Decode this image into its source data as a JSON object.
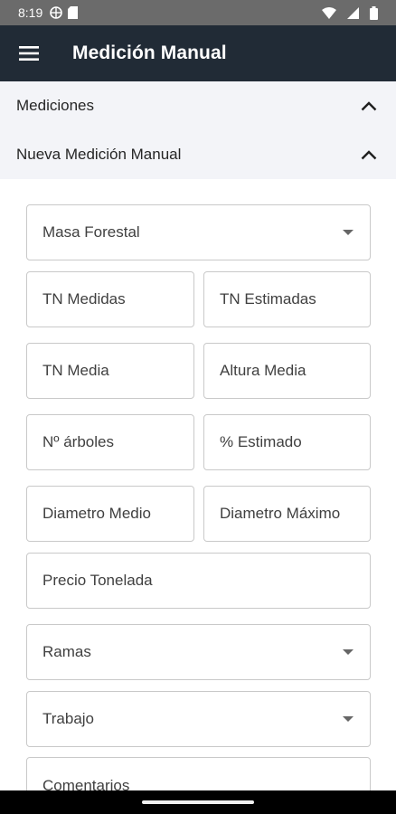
{
  "status_bar": {
    "time": "8:19",
    "icons_left": [
      "globe-icon",
      "sim-card-icon"
    ],
    "icons_right": [
      "wifi-icon",
      "signal-icon",
      "battery-icon"
    ]
  },
  "app_bar": {
    "title": "Medición Manual",
    "menu_icon": "hamburger-menu-icon",
    "background": "#212b36"
  },
  "sections": [
    {
      "label": "Mediciones",
      "expanded": true
    },
    {
      "label": "Nueva Medición Manual",
      "expanded": true
    }
  ],
  "form": {
    "masa_forestal": {
      "placeholder": "Masa Forestal",
      "type": "dropdown"
    },
    "tn_medidas": {
      "placeholder": "TN Medidas"
    },
    "tn_estimadas": {
      "placeholder": "TN Estimadas"
    },
    "tn_media": {
      "placeholder": "TN Media"
    },
    "altura_media": {
      "placeholder": "Altura Media"
    },
    "n_arboles": {
      "placeholder": "Nº árboles"
    },
    "pct_estimado": {
      "placeholder": "% Estimado"
    },
    "diametro_medio": {
      "placeholder": "Diametro Medio"
    },
    "diametro_maximo": {
      "placeholder": "Diametro Máximo"
    },
    "precio_tonelada": {
      "placeholder": "Precio Tonelada"
    },
    "ramas": {
      "placeholder": "Ramas",
      "type": "dropdown"
    },
    "trabajo": {
      "placeholder": "Trabajo",
      "type": "dropdown"
    },
    "comentarios": {
      "placeholder": "Comentarios"
    }
  }
}
